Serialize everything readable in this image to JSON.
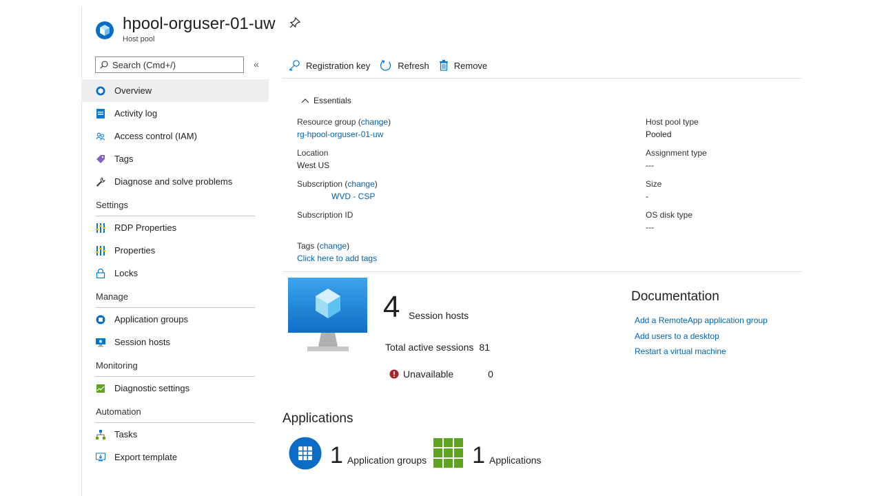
{
  "header": {
    "title": "hpool-orguser-01-uw",
    "subtitle": "Host pool",
    "icon": "host-pool-icon",
    "pin_icon": "pin-icon"
  },
  "sidebar": {
    "search_placeholder": "Search (Cmd+/)",
    "collapse_label": "«",
    "items": [
      {
        "label": "Overview",
        "icon": "overview-icon",
        "active": true
      },
      {
        "label": "Activity log",
        "icon": "activity-log-icon"
      },
      {
        "label": "Access control (IAM)",
        "icon": "people-icon"
      },
      {
        "label": "Tags",
        "icon": "tag-icon"
      },
      {
        "label": "Diagnose and solve problems",
        "icon": "wrench-icon"
      }
    ],
    "sections": [
      {
        "title": "Settings",
        "items": [
          {
            "label": "RDP Properties",
            "icon": "sliders-icon"
          },
          {
            "label": "Properties",
            "icon": "sliders-icon"
          },
          {
            "label": "Locks",
            "icon": "lock-icon"
          }
        ]
      },
      {
        "title": "Manage",
        "items": [
          {
            "label": "Application groups",
            "icon": "app-group-icon"
          },
          {
            "label": "Session hosts",
            "icon": "monitor-icon"
          }
        ]
      },
      {
        "title": "Monitoring",
        "items": [
          {
            "label": "Diagnostic settings",
            "icon": "diagnostic-icon"
          }
        ]
      },
      {
        "title": "Automation",
        "items": [
          {
            "label": "Tasks",
            "icon": "tasks-icon"
          },
          {
            "label": "Export template",
            "icon": "export-icon"
          }
        ]
      }
    ]
  },
  "toolbar": {
    "registration_key": "Registration key",
    "refresh": "Refresh",
    "remove": "Remove"
  },
  "essentials": {
    "toggle_label": "Essentials",
    "resource_group_label": "Resource group",
    "resource_group_change": "change",
    "resource_group_value": "rg-hpool-orguser-01-uw",
    "location_label": "Location",
    "location_value": "West US",
    "subscription_label": "Subscription",
    "subscription_change": "change",
    "subscription_value": "WVD - CSP",
    "subscription_id_label": "Subscription ID",
    "tags_label": "Tags",
    "tags_change": "change",
    "tags_value": "Click here to add tags",
    "host_pool_type_label": "Host pool type",
    "host_pool_type_value": "Pooled",
    "assignment_type_label": "Assignment type",
    "assignment_type_value": "---",
    "size_label": "Size",
    "size_value": "-",
    "os_disk_type_label": "OS disk type",
    "os_disk_type_value": "---"
  },
  "session_hosts": {
    "count": "4",
    "label": "Session hosts",
    "active_sessions_label": "Total active sessions",
    "active_sessions_value": "81",
    "unavailable_label": "Unavailable",
    "unavailable_value": "0"
  },
  "documentation": {
    "title": "Documentation",
    "links": [
      "Add a RemoteApp application group",
      "Add users to a desktop",
      "Restart a virtual machine"
    ]
  },
  "applications": {
    "title": "Applications",
    "app_groups_count": "1",
    "app_groups_label": "Application groups",
    "apps_count": "1",
    "apps_label": "Applications"
  },
  "colors": {
    "link": "#0063b1",
    "azure_blue": "#0078d4",
    "green": "#5ea51f",
    "error_red": "#a4262c"
  }
}
